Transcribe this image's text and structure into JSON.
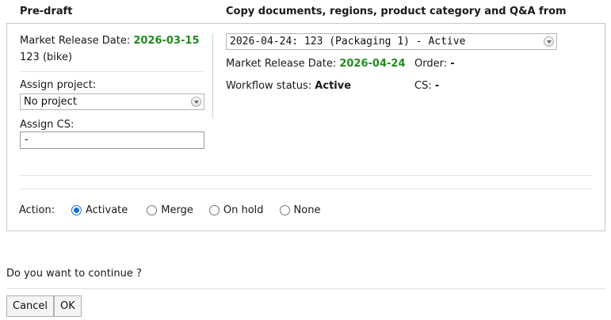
{
  "header": {
    "left_title": "Pre-draft",
    "right_title": "Copy documents, regions, product category and Q&A from"
  },
  "left": {
    "market_release_label": "Market Release Date:",
    "market_release_date": "2026-03-15",
    "product": "123 (bike)",
    "assign_project_label": "Assign project:",
    "assign_project_value": "No project",
    "assign_cs_label": "Assign CS:",
    "assign_cs_value": "-"
  },
  "right": {
    "source_select_value": "2026-04-24: 123 (Packaging 1) - Active",
    "market_release_label": "Market Release Date:",
    "market_release_date": "2026-04-24",
    "order_label": "Order:",
    "order_value": "-",
    "workflow_label": "Workflow status:",
    "workflow_value": "Active",
    "cs_label": "CS:",
    "cs_value": "-"
  },
  "action": {
    "label": "Action:",
    "options": [
      {
        "label": "Activate",
        "checked": true
      },
      {
        "label": "Merge",
        "checked": false
      },
      {
        "label": "On hold",
        "checked": false
      },
      {
        "label": "None",
        "checked": false
      }
    ]
  },
  "footer": {
    "question": "Do you want to continue ?",
    "cancel_label": "Cancel",
    "ok_label": "OK"
  },
  "colors": {
    "date_green": "#1f8a1f",
    "radio_accent": "#1a6fe0"
  }
}
